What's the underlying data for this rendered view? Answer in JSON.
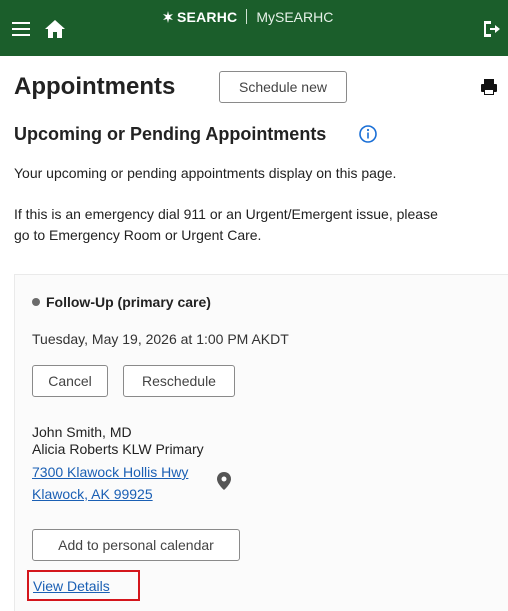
{
  "topbar": {
    "brand_name": "SEARHC",
    "portal_name": "MySEARHC",
    "icons": [
      "menu-icon",
      "home-icon",
      "logo-icon",
      "logout-icon"
    ]
  },
  "header": {
    "title": "Appointments",
    "schedule_label": "Schedule new",
    "print_icon": "print-icon"
  },
  "section": {
    "title": "Upcoming or Pending Appointments",
    "info_icon": "info-icon",
    "description": "Your upcoming or pending appointments display on this page.",
    "emergency_line1": "If this is an emergency dial 911 or an Urgent/Emergent issue, please",
    "emergency_line2": "go to Emergency Room or Urgent Care."
  },
  "appointment": {
    "type": "Follow-Up (primary care)",
    "date": "Tuesday, May 19, 2026 at 1:00 PM AKDT",
    "cancel_label": "Cancel",
    "reschedule_label": "Reschedule",
    "provider": "John Smith, MD",
    "clinic": "Alicia Roberts KLW Primary",
    "address_line1": "7300 Klawock Hollis Hwy",
    "address_line2": "Klawock, AK 99925",
    "calendar_label": "Add to personal calendar",
    "details_label": "View Details"
  },
  "colors": {
    "topbar": "#1b5e2b",
    "link": "#1a5fb4",
    "highlight": "#d4161c",
    "info": "#1a6fd6"
  }
}
